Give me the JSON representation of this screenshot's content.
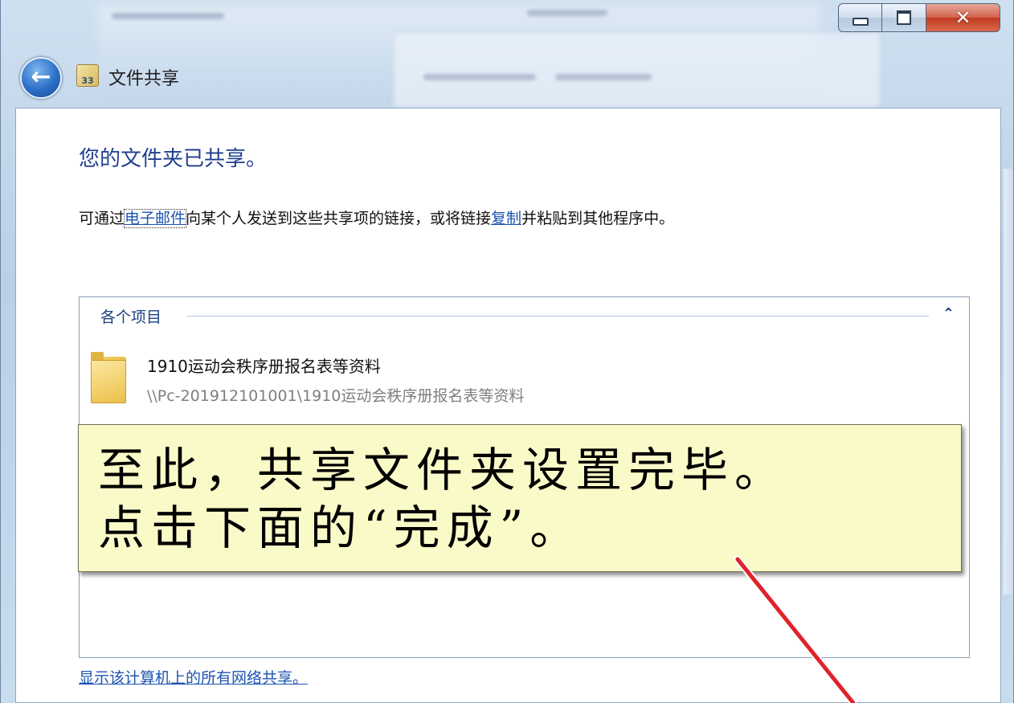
{
  "window": {
    "title": "文件共享",
    "caption_buttons": {
      "minimize": "minimize-icon",
      "maximize": "maximize-icon",
      "close": "✕"
    },
    "back_icon": "back-arrow-icon",
    "title_icon_text": "33"
  },
  "content": {
    "heading": "您的文件夹已共享。",
    "description": {
      "prefix": "可通过",
      "email_link": "电子邮件",
      "middle": "向某个人发送到这些共享项的链接，或将链接",
      "copy_link": "复制",
      "suffix": "并粘贴到其他程序中。"
    },
    "items_group": {
      "title": "各个项目",
      "collapse_glyph": "⌃",
      "items": [
        {
          "name": "1910运动会秩序册报名表等资料",
          "path": "\\\\Pc-201912101001\\1910运动会秩序册报名表等资料",
          "icon": "folder-icon"
        }
      ]
    },
    "bottom_link": "显示该计算机上的所有网络共享。"
  },
  "callout": {
    "line1": "至此，共享文件夹设置完毕。",
    "line2": "点击下面的“完成”。"
  },
  "colors": {
    "heading": "#1f3f8f",
    "link": "#1c54b0",
    "callout_bg": "#fafac8",
    "arrow": "#e0222a"
  }
}
